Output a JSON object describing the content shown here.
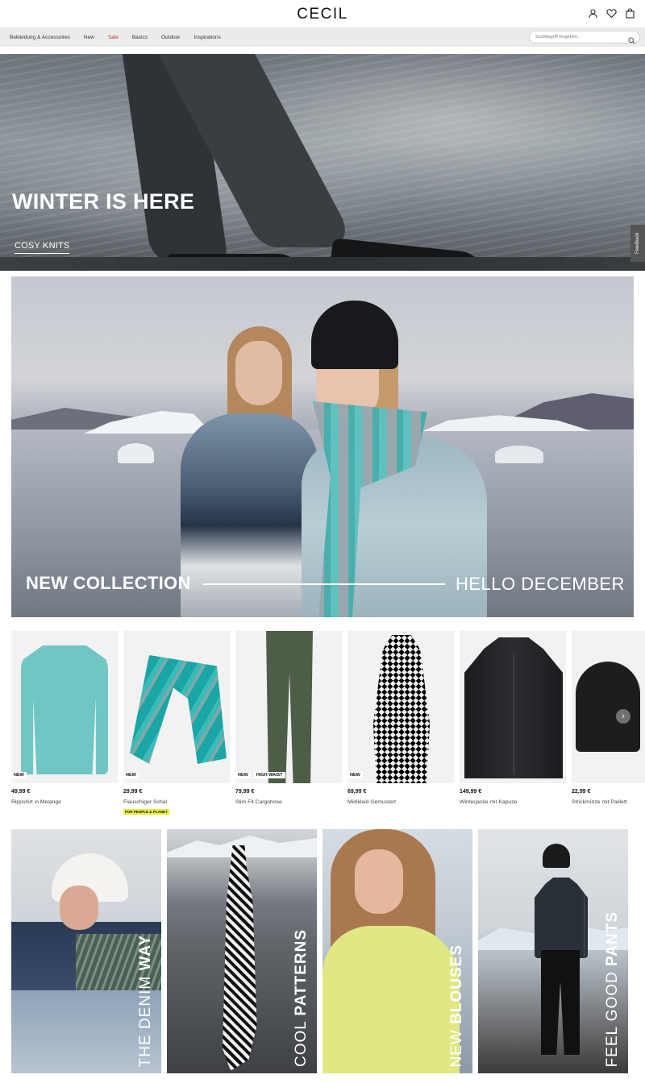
{
  "header": {
    "logo": "CECIL",
    "icons": [
      "user-icon",
      "heart-icon",
      "bag-icon"
    ]
  },
  "nav": {
    "items": [
      {
        "label": "Bekleidung & Accessoires"
      },
      {
        "label": "New"
      },
      {
        "label": "Sale"
      },
      {
        "label": "Basics"
      },
      {
        "label": "Outdoor"
      },
      {
        "label": "Inspirations"
      }
    ],
    "search_placeholder": "Suchbegriff eingeben..."
  },
  "hero1": {
    "title": "WINTER IS HERE",
    "link": "COSY KNITS"
  },
  "feedback": "Feedback",
  "hero2": {
    "title": "NEW COLLECTION",
    "subtitle": "HELLO DECEMBER"
  },
  "products": [
    {
      "badges": [
        "NEW"
      ],
      "price": "49,99 €",
      "name": "Rippshirt in Melange",
      "eco": ""
    },
    {
      "badges": [
        "NEW"
      ],
      "price": "29,99 €",
      "name": "Flauschiger Schal",
      "eco": "FOR PEOPLE & PLANET"
    },
    {
      "badges": [
        "NEW",
        "HIGH WAIST"
      ],
      "price": "79,99 €",
      "name": "Slim Fit Cargohose",
      "eco": ""
    },
    {
      "badges": [
        "NEW"
      ],
      "price": "69,99 €",
      "name": "Midikleid Gemustert",
      "eco": ""
    },
    {
      "badges": [],
      "price": "149,99 €",
      "name": "Winterjacke mit Kapuze",
      "eco": ""
    },
    {
      "badges": [],
      "price": "22,99 €",
      "name": "Strickmütze mit Paillett",
      "eco": ""
    }
  ],
  "categories": [
    {
      "light": "THE DENIM ",
      "bold": "WAY"
    },
    {
      "light": "COOL ",
      "bold": "PATTERNS"
    },
    {
      "light": "NEW ",
      "bold": "BLOUSES"
    },
    {
      "light": "FEEL GOOD ",
      "bold": "PANTS"
    }
  ]
}
